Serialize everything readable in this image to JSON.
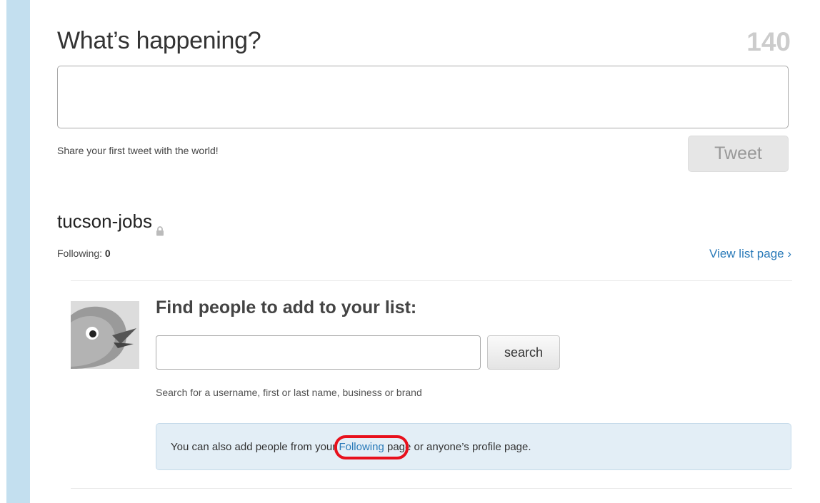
{
  "composer": {
    "title": "What’s happening?",
    "char_count": "140",
    "placeholder": "",
    "hint": "Share your first tweet with the world!",
    "tweet_label": "Tweet"
  },
  "list": {
    "name": "tucson-jobs",
    "following_label": "Following:",
    "following_count": "0",
    "view_list_label": "View list page ›"
  },
  "finder": {
    "title": "Find people to add to your list:",
    "search_value": "",
    "search_button": "search",
    "search_hint": "Search for a username, first or last name, business or brand",
    "info_prefix": "You can also add people from your ",
    "info_link": "Following",
    "info_suffix": " page or anyone’s profile page."
  },
  "colors": {
    "accent": "#2b7bb9",
    "sidebar": "#c3dfef",
    "highlight": "#e8101c"
  }
}
